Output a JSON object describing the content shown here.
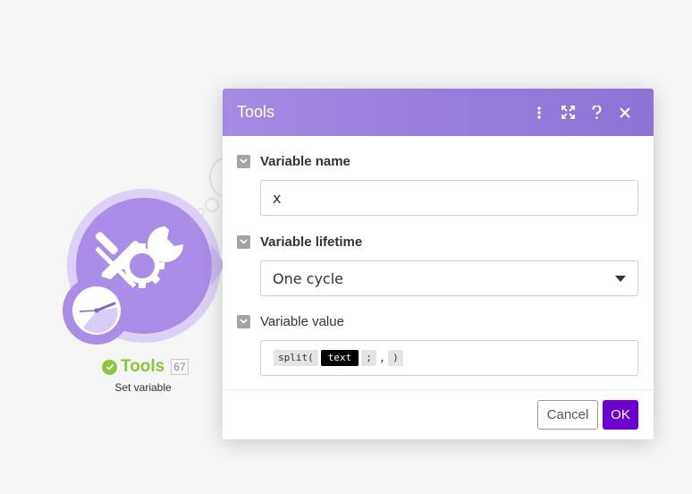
{
  "module": {
    "title": "Tools",
    "id": "67",
    "subtitle": "Set variable",
    "status_color": "#8cc63f",
    "icon": "tools-icon",
    "badge_icon": "clock-icon"
  },
  "dialog": {
    "title": "Tools",
    "header_color": "#9a80dc",
    "actions": [
      "more-icon",
      "expand-icon",
      "help-icon",
      "close-icon"
    ],
    "fields": {
      "name": {
        "label": "Variable name",
        "value": "x"
      },
      "lifetime": {
        "label": "Variable lifetime",
        "value": "One cycle"
      },
      "value": {
        "label": "Variable value",
        "tokens": {
          "fn_open": "split(",
          "variable": "text",
          "separator": ";",
          "comma": ",",
          "fn_close": ")"
        }
      }
    },
    "footer": {
      "cancel_label": "Cancel",
      "ok_label": "OK",
      "ok_color": "#6d00cc"
    }
  }
}
